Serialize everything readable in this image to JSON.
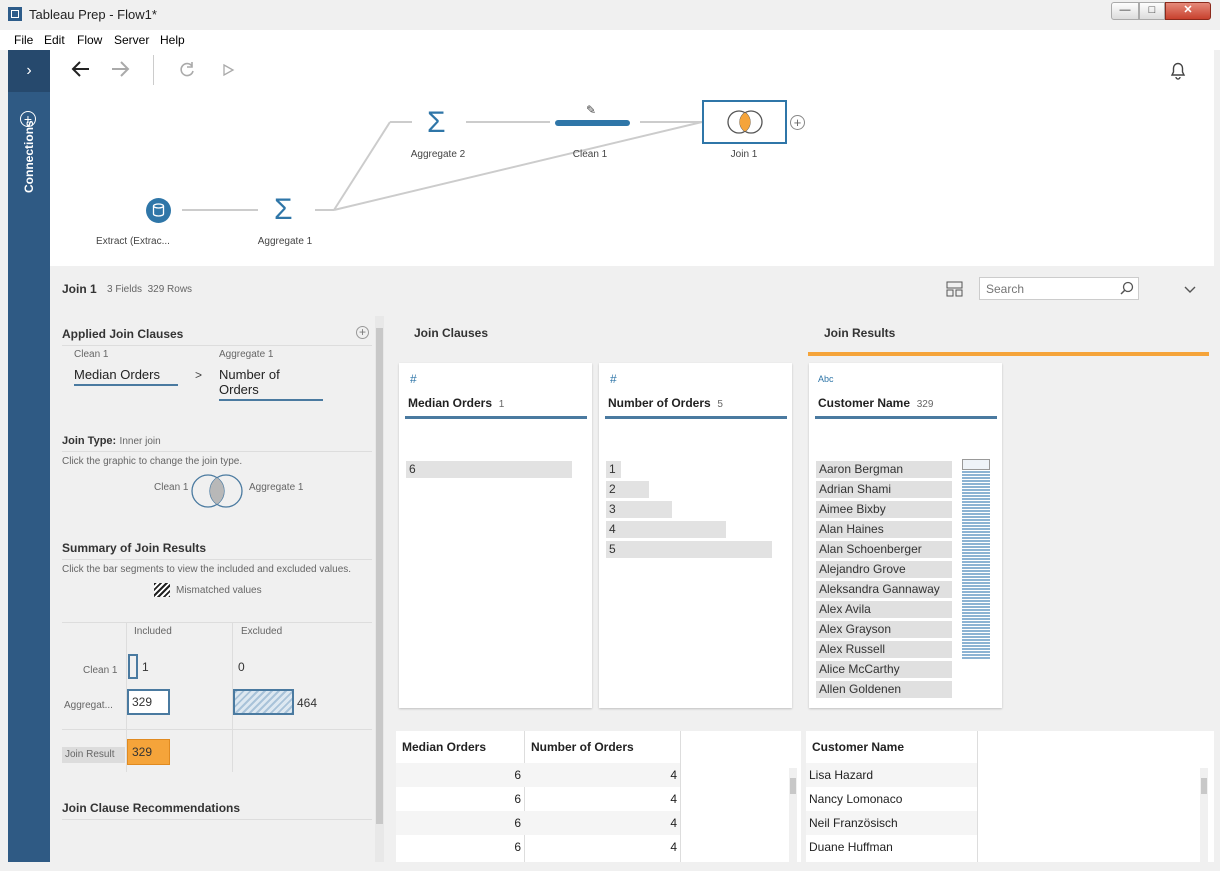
{
  "window": {
    "title": "Tableau Prep - Flow1*",
    "min": "—",
    "max": "□",
    "close": "✕"
  },
  "menu": [
    "File",
    "Edit",
    "Flow",
    "Server",
    "Help"
  ],
  "rail": {
    "label": "Connections"
  },
  "flow": {
    "nodes": {
      "extract": "Extract (Extrac...",
      "aggregate1": "Aggregate 1",
      "aggregate2": "Aggregate 2",
      "clean1": "Clean 1",
      "join1": "Join 1"
    }
  },
  "profile": {
    "title": "Join 1",
    "fields": "3 Fields",
    "rows": "329 Rows",
    "search_placeholder": "Search"
  },
  "left": {
    "applied_title": "Applied Join Clauses",
    "clause_left_source": "Clean 1",
    "clause_right_source": "Aggregate 1",
    "clause_left_field": "Median Orders",
    "clause_operator": ">",
    "clause_right_field": "Number of Orders",
    "join_type_label": "Join Type:",
    "join_type_value": "Inner join",
    "join_hint": "Click the graphic to change the join type.",
    "venn_left": "Clean 1",
    "venn_right": "Aggregate 1",
    "summary_title": "Summary of Join Results",
    "summary_hint": "Click the bar segments to view the included and excluded values.",
    "mismatched": "Mismatched values",
    "col_included": "Included",
    "col_excluded": "Excluded",
    "row1_label": "Clean 1",
    "row1_included": "1",
    "row1_excluded": "0",
    "row2_label": "Aggregat...",
    "row2_included": "329",
    "row2_excluded": "464",
    "result_label": "Join Result",
    "result_value": "329",
    "recommend_title": "Join Clause Recommendations"
  },
  "clauses": {
    "title": "Join Clauses",
    "card1": {
      "type_icon": "#",
      "name": "Median Orders",
      "count": "1",
      "values": [
        "6"
      ]
    },
    "card2": {
      "type_icon": "#",
      "name": "Number of Orders",
      "count": "5",
      "values": [
        "1",
        "2",
        "3",
        "4",
        "5"
      ],
      "fills": [
        0.09,
        0.26,
        0.4,
        0.72,
        1.0
      ]
    }
  },
  "results": {
    "title": "Join Results",
    "card": {
      "type_icon": "Abc",
      "name": "Customer Name",
      "count": "329",
      "values": [
        "Aaron Bergman",
        "Adrian Shami",
        "Aimee Bixby",
        "Alan Haines",
        "Alan Schoenberger",
        "Alejandro Grove",
        "Aleksandra Gannaway",
        "Alex Avila",
        "Alex Grayson",
        "Alex Russell",
        "Alice McCarthy",
        "Allen Goldenen"
      ]
    }
  },
  "grid_left": {
    "headers": [
      "Median Orders",
      "Number of Orders"
    ],
    "rows": [
      [
        "6",
        "4"
      ],
      [
        "6",
        "4"
      ],
      [
        "6",
        "4"
      ],
      [
        "6",
        "4"
      ]
    ]
  },
  "grid_right": {
    "headers": [
      "Customer Name"
    ],
    "rows": [
      "Lisa Hazard",
      "Nancy Lomonaco",
      "Neil Französisch",
      "Duane Huffman"
    ]
  },
  "colors": {
    "accent": "#2f5a84",
    "blue": "#4a7aa0",
    "orange": "#f5a43a",
    "rail": "#2f5a84"
  }
}
